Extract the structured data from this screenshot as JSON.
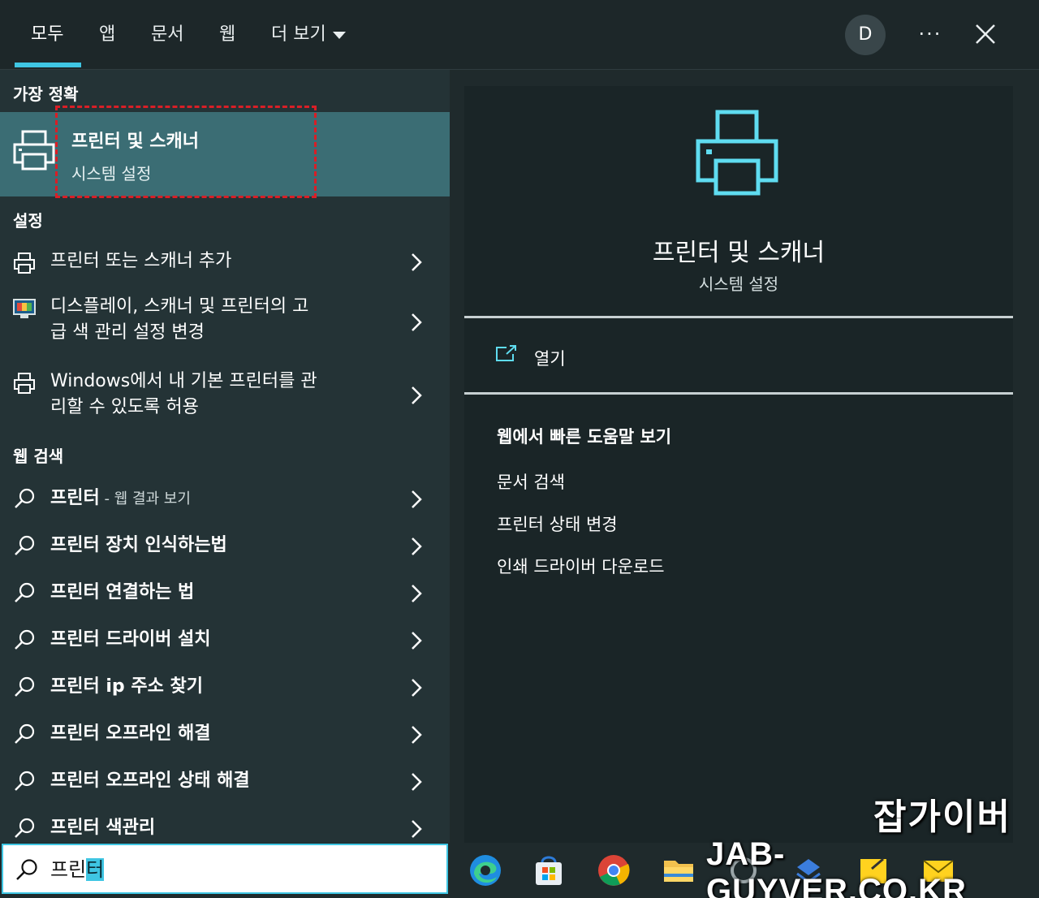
{
  "tabs": [
    {
      "label": "모두",
      "active": true
    },
    {
      "label": "앱"
    },
    {
      "label": "문서"
    },
    {
      "label": "웹"
    },
    {
      "label": "더 보기"
    }
  ],
  "header": {
    "avatar_initial": "D",
    "more_label": "···"
  },
  "left": {
    "best_match_heading": "가장 정확",
    "best_match": {
      "title": "프린터 및 스캐너",
      "subtitle": "시스템 설정",
      "icon": "printer-icon"
    },
    "settings_heading": "설정",
    "settings": [
      {
        "line1": "프린터 또는 스캐너 추가",
        "line2": "",
        "icon": "printer-icon"
      },
      {
        "line1": "디스플레이, 스캐너 및 프린터의 고",
        "line2": "급 색 관리 설정 변경",
        "icon": "display-color-icon"
      },
      {
        "line1": "Windows에서 내 기본 프린터를 관",
        "line2": "리할 수 있도록 허용",
        "icon": "printer-icon"
      }
    ],
    "web_heading": "웹 검색",
    "web": [
      {
        "label": "프린터",
        "suffix": " - 웹 결과 보기"
      },
      {
        "label": "프린터 장치 인식하는법"
      },
      {
        "label": "프린터 연결하는 법"
      },
      {
        "label": "프린터 드라이버 설치"
      },
      {
        "label": "프린터 ip 주소 찾기"
      },
      {
        "label": "프린터 오프라인 해결"
      },
      {
        "label": "프린터 오프라인 상태 해결"
      },
      {
        "label": "프린터 색관리"
      }
    ]
  },
  "search": {
    "typed": "프린",
    "selected": "터"
  },
  "right": {
    "title": "프린터 및 스캐너",
    "subtitle": "시스템 설정",
    "open_label": "열기",
    "help_heading": "웹에서 빠른 도움말 보기",
    "help_links": [
      "문서 검색",
      "프린터 상태 변경",
      "인쇄 드라이버 다운로드"
    ]
  },
  "taskbar": {
    "icons": [
      "edge-icon",
      "store-icon",
      "chrome-icon",
      "file-explorer-icon",
      "app-icon",
      "app-icon",
      "sticky-notes-icon",
      "mail-icon"
    ]
  },
  "watermark": {
    "line1": "잡가이버",
    "line2": "JAB-GUYVER.CO.KR"
  },
  "colors": {
    "accent": "#3fc6e3",
    "highlight_bg": "#3b6d74",
    "panel_bg": "#243336",
    "dashed_red": "#d91e26"
  }
}
